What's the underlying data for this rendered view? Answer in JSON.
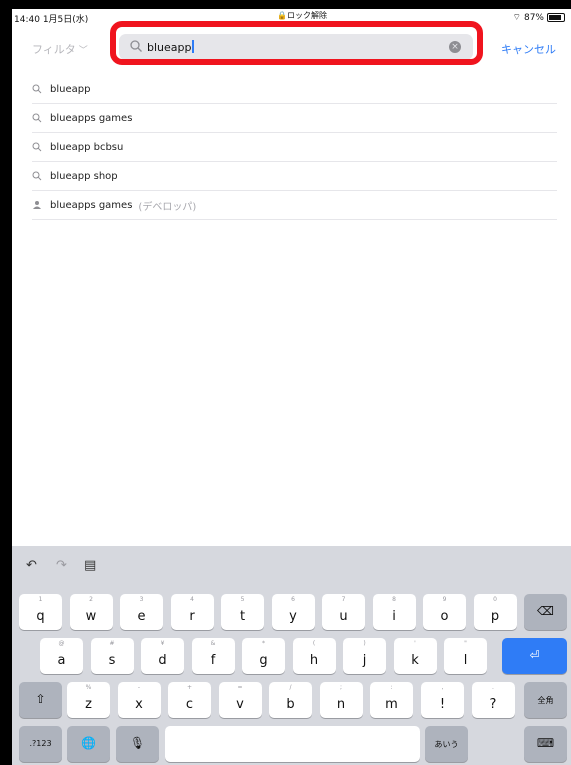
{
  "status_bar": {
    "time": "14:40",
    "date": "1月5日(水)",
    "lock": "ロック解除",
    "battery": "87%"
  },
  "navbar": {
    "filter_label": "フィルタ",
    "search_value": "blueapp",
    "cancel_label": "キャンセル"
  },
  "suggestions": [
    {
      "text": "blueapp",
      "icon": "search-icon"
    },
    {
      "text": "blueapps games",
      "icon": "search-icon"
    },
    {
      "text": "blueapp bcbsu",
      "icon": "search-icon"
    },
    {
      "text": "blueapp shop",
      "icon": "search-icon"
    },
    {
      "text": "blueapps games",
      "icon": "person-icon",
      "badge": "(デベロッパ)"
    }
  ],
  "keyboard": {
    "toolbar": [
      "undo-icon",
      "redo-icon",
      "paste-icon"
    ],
    "row1": [
      {
        "main": "q",
        "sub": "1"
      },
      {
        "main": "w",
        "sub": "2"
      },
      {
        "main": "e",
        "sub": "3"
      },
      {
        "main": "r",
        "sub": "4"
      },
      {
        "main": "t",
        "sub": "5"
      },
      {
        "main": "y",
        "sub": "6"
      },
      {
        "main": "u",
        "sub": "7"
      },
      {
        "main": "i",
        "sub": "8"
      },
      {
        "main": "o",
        "sub": "9"
      },
      {
        "main": "p",
        "sub": "0"
      }
    ],
    "row2": [
      {
        "main": "a",
        "sub": "@"
      },
      {
        "main": "s",
        "sub": "#"
      },
      {
        "main": "d",
        "sub": "¥"
      },
      {
        "main": "f",
        "sub": "&"
      },
      {
        "main": "g",
        "sub": "*"
      },
      {
        "main": "h",
        "sub": "("
      },
      {
        "main": "j",
        "sub": ")"
      },
      {
        "main": "k",
        "sub": "'"
      },
      {
        "main": "l",
        "sub": "\""
      }
    ],
    "row3": [
      {
        "main": "z",
        "sub": "%"
      },
      {
        "main": "x",
        "sub": "-"
      },
      {
        "main": "c",
        "sub": "+"
      },
      {
        "main": "v",
        "sub": "="
      },
      {
        "main": "b",
        "sub": "/"
      },
      {
        "main": "n",
        "sub": ";"
      },
      {
        "main": "m",
        "sub": ":"
      }
    ],
    "row3_extra": [
      {
        "main": "!",
        "sub": ","
      },
      {
        "main": "?",
        "sub": "."
      }
    ],
    "zenkaku_label": "全角",
    "numbers_label": ".?123",
    "kana_label": "あいう"
  }
}
